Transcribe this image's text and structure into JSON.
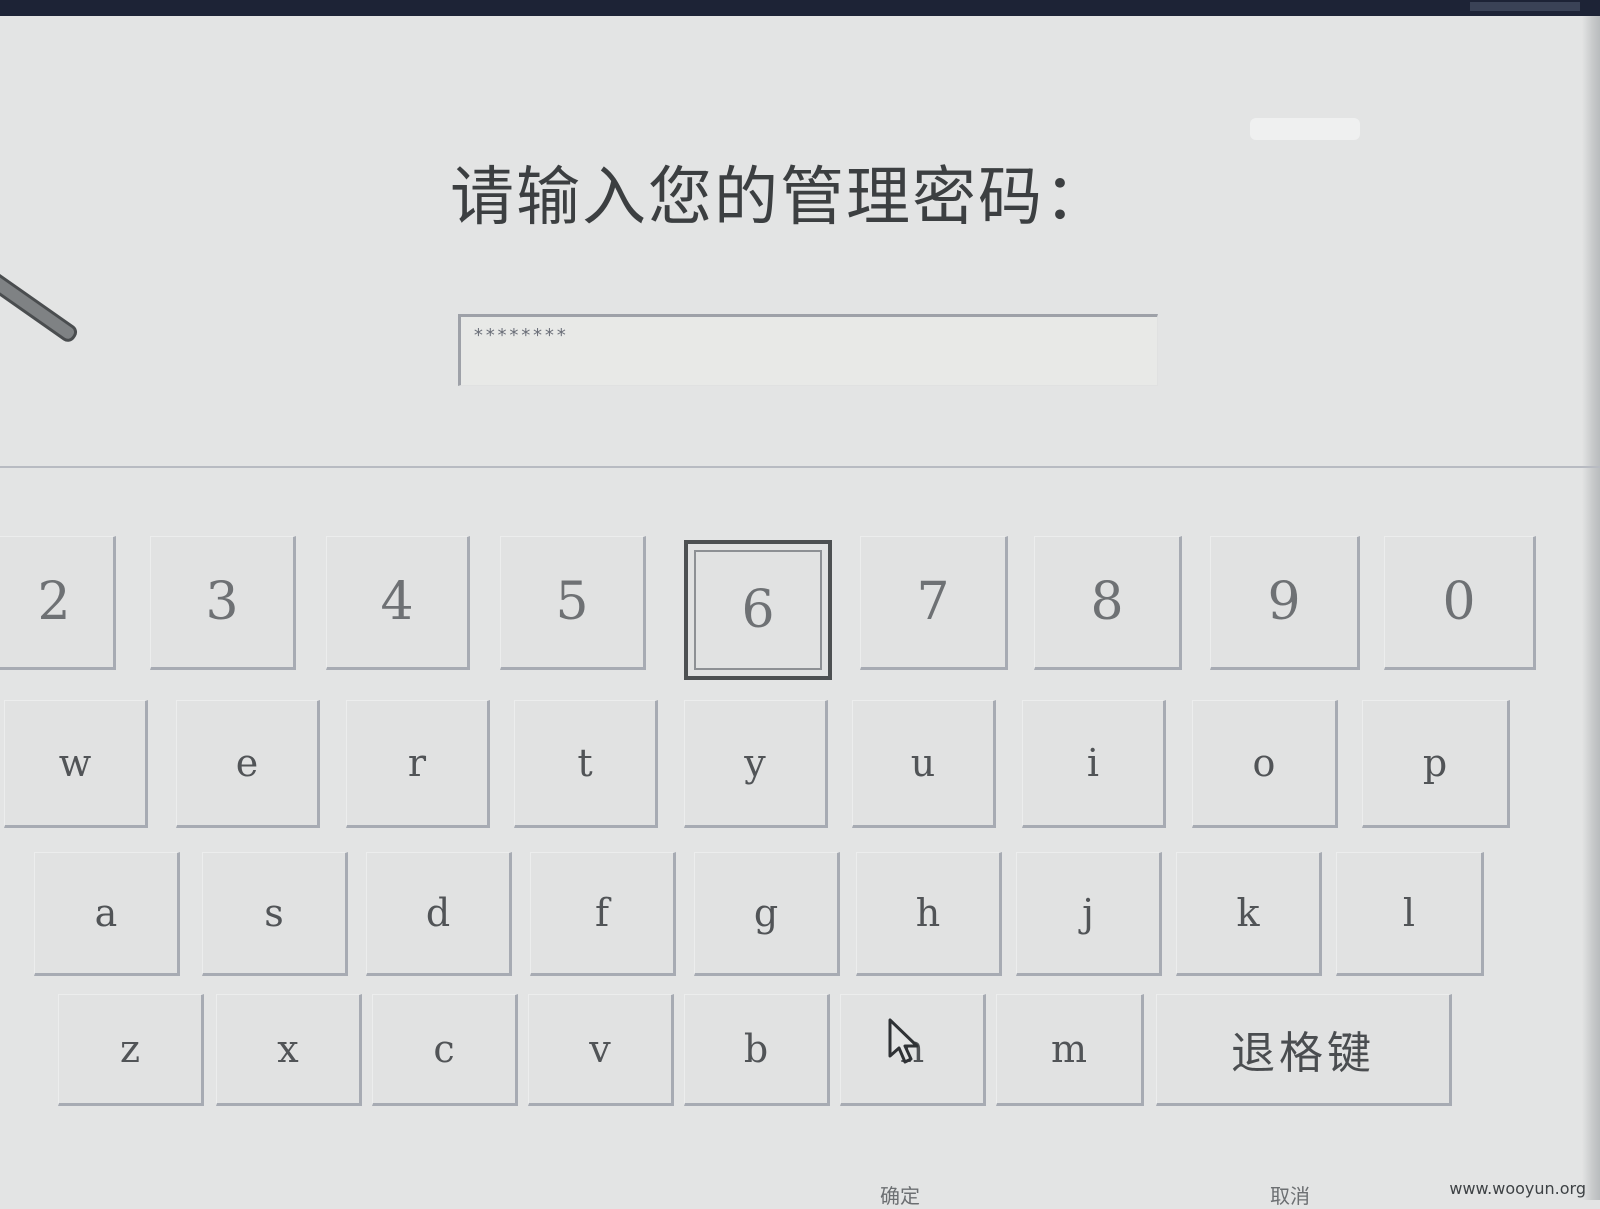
{
  "dialog": {
    "prompt": "请输入您的管理密码：",
    "password_value": "********"
  },
  "keyboard": {
    "row_numbers": [
      "2",
      "3",
      "4",
      "5",
      "6",
      "7",
      "8",
      "9",
      "0"
    ],
    "row_qwerty": [
      "w",
      "e",
      "r",
      "t",
      "y",
      "u",
      "i",
      "o",
      "p"
    ],
    "row_asdf": [
      "a",
      "s",
      "d",
      "f",
      "g",
      "h",
      "j",
      "k",
      "l"
    ],
    "row_zxcv": [
      "z",
      "x",
      "c",
      "v",
      "b",
      "n",
      "m"
    ],
    "backspace_label": "退格键",
    "selected_key": "6"
  },
  "footer": {
    "ok_label": "确定",
    "cancel_label": "取消"
  },
  "watermark": "www.wooyun.org",
  "colors": {
    "background": "#e3e4e4",
    "key_face": "#e1e2e2",
    "key_shadow": "#a7abb3",
    "text": "#3c3f41",
    "top_bar": "#1d2336"
  }
}
